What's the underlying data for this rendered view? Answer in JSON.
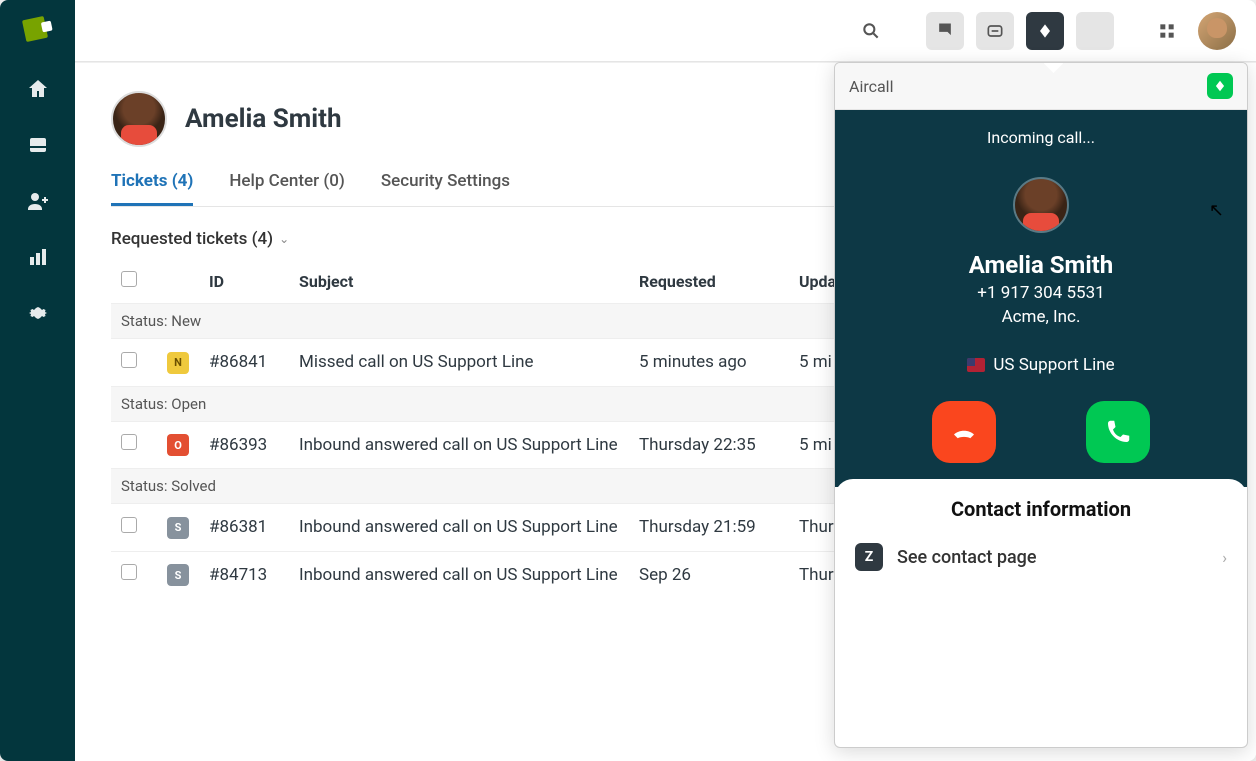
{
  "profile": {
    "name": "Amelia Smith"
  },
  "tabs": [
    {
      "label": "Tickets (4)",
      "active": true
    },
    {
      "label": "Help Center (0)",
      "active": false
    },
    {
      "label": "Security Settings",
      "active": false
    }
  ],
  "section_title": "Requested tickets (4)",
  "columns": {
    "id": "ID",
    "subject": "Subject",
    "requested": "Requested",
    "updated": "Upda"
  },
  "statuses": {
    "new": "Status: New",
    "open": "Status: Open",
    "solved": "Status: Solved"
  },
  "tickets": [
    {
      "badge": "N",
      "id": "#86841",
      "subject": "Missed call on US Support Line",
      "requested": "5 minutes ago",
      "updated": "5 mi"
    },
    {
      "badge": "O",
      "id": "#86393",
      "subject": "Inbound answered call on US Support Line",
      "requested": "Thursday 22:35",
      "updated": "5 mi"
    },
    {
      "badge": "S",
      "id": "#86381",
      "subject": "Inbound answered call on US Support Line",
      "requested": "Thursday 21:59",
      "updated": "Thur"
    },
    {
      "badge": "S",
      "id": "#84713",
      "subject": "Inbound answered call on US Support Line",
      "requested": "Sep 26",
      "updated": "Thur"
    }
  ],
  "call_panel": {
    "app_name": "Aircall",
    "status": "Incoming call...",
    "caller_name": "Amelia Smith",
    "caller_phone": "+1 917 304 5531",
    "caller_company": "Acme, Inc.",
    "line": "US Support Line",
    "contact_title": "Contact information",
    "contact_link": "See contact page"
  }
}
